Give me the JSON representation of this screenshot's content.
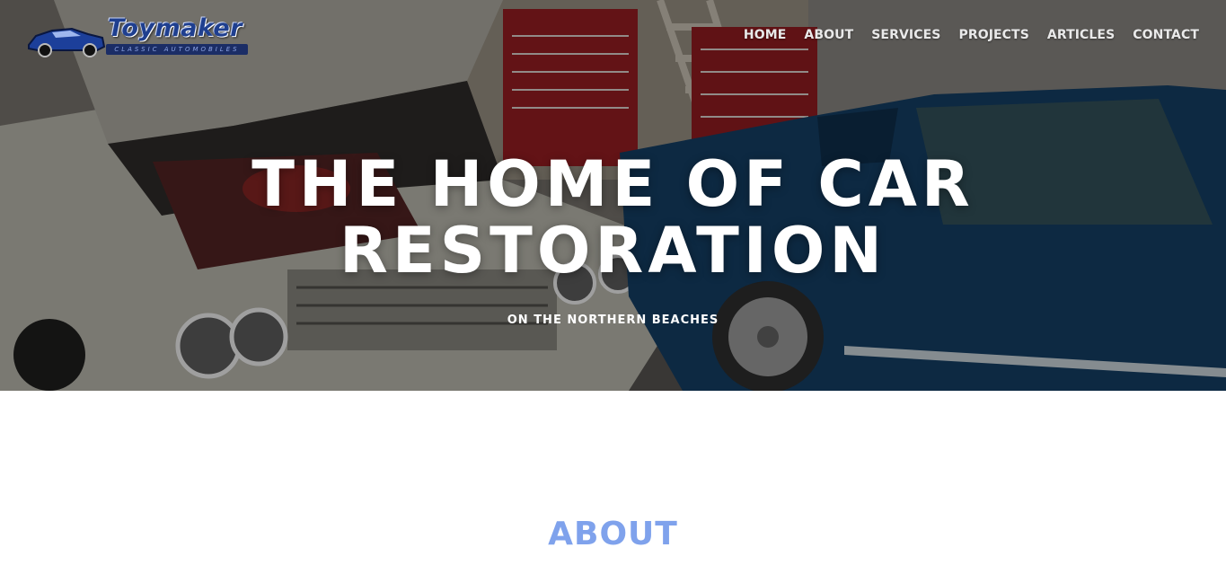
{
  "logo": {
    "name": "Toymaker",
    "tagline": "CLASSIC AUTOMOBILES"
  },
  "nav": {
    "items": [
      {
        "label": "HOME"
      },
      {
        "label": "ABOUT"
      },
      {
        "label": "SERVICES"
      },
      {
        "label": "PROJECTS"
      },
      {
        "label": "ARTICLES"
      },
      {
        "label": "CONTACT"
      }
    ]
  },
  "hero": {
    "title": "THE HOME OF CAR RESTORATION",
    "subtitle": "ON THE NORTHERN BEACHES",
    "image_description_icon": "garage-cars-photo"
  },
  "about": {
    "heading": "ABOUT"
  },
  "colors": {
    "accent": "#7fa2ec",
    "nav_text": "#e9e9e9",
    "logo_blue": "#1f3f8f"
  }
}
